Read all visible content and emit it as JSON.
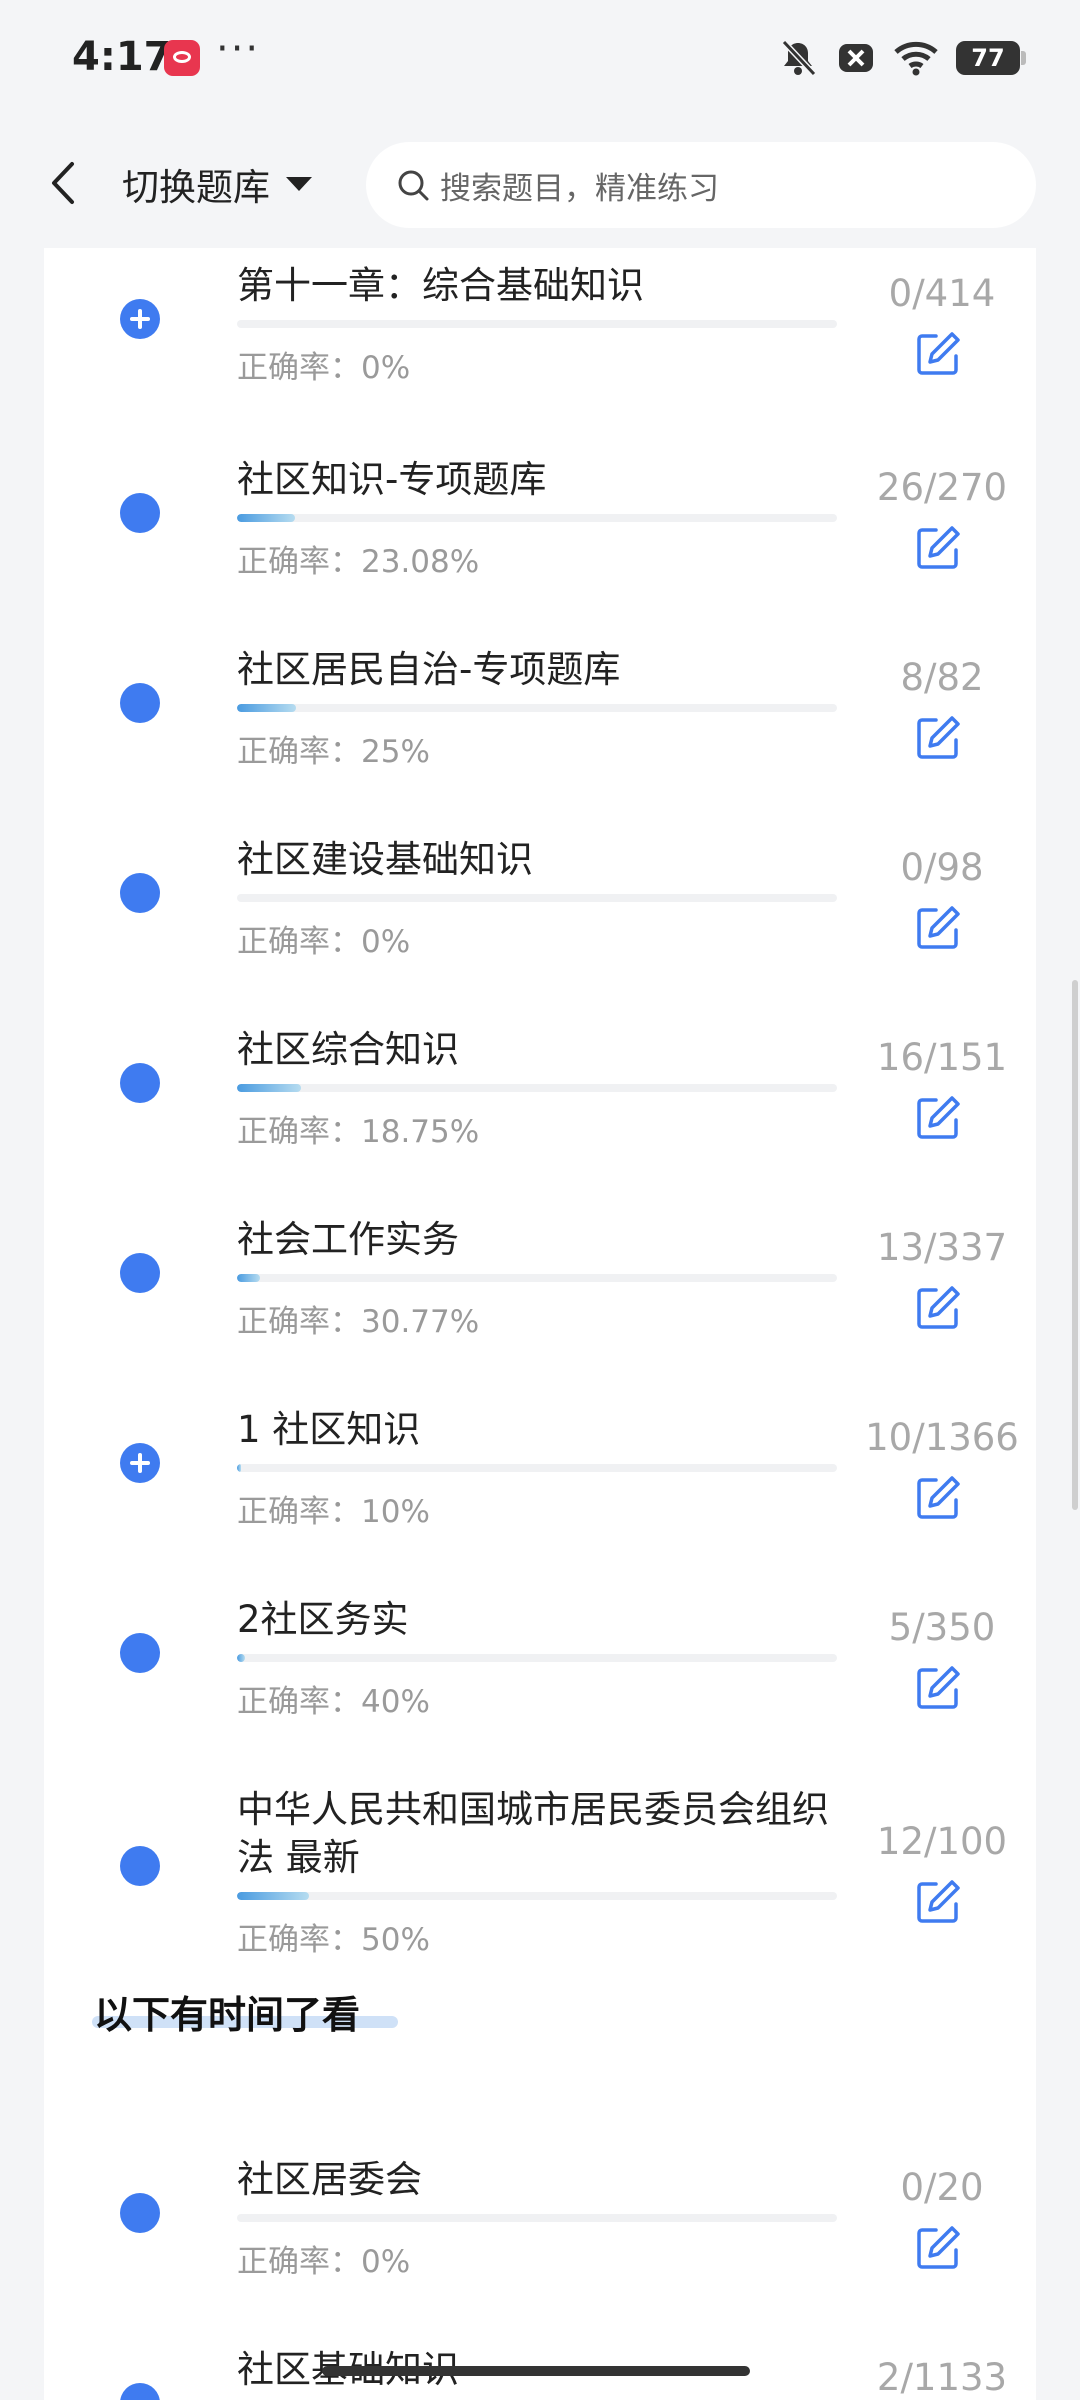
{
  "status": {
    "time": "4:17",
    "more": "···",
    "battery": "77"
  },
  "header": {
    "switch_label": "切换题库",
    "search_placeholder": "搜索题目，精准练习"
  },
  "rate_prefix": "正确率：",
  "items": [
    {
      "title": "第十一章：综合基础知识",
      "count": "0/414",
      "rate": "正确率：0%",
      "progress": 0.0,
      "expandable": true
    },
    {
      "title": "社区知识-专项题库",
      "count": "26/270",
      "rate": "正确率：23.08%",
      "progress": 0.096,
      "expandable": false
    },
    {
      "title": "社区居民自治-专项题库",
      "count": "8/82",
      "rate": "正确率：25%",
      "progress": 0.098,
      "expandable": false
    },
    {
      "title": "社区建设基础知识",
      "count": "0/98",
      "rate": "正确率：0%",
      "progress": 0.0,
      "expandable": false
    },
    {
      "title": "社区综合知识",
      "count": "16/151",
      "rate": "正确率：18.75%",
      "progress": 0.106,
      "expandable": false
    },
    {
      "title": "社会工作实务",
      "count": "13/337",
      "rate": "正确率：30.77%",
      "progress": 0.039,
      "expandable": false
    },
    {
      "title": "1 社区知识",
      "count": "10/1366",
      "rate": "正确率：10%",
      "progress": 0.007,
      "expandable": true
    },
    {
      "title": "2社区务实",
      "count": "5/350",
      "rate": "正确率：40%",
      "progress": 0.014,
      "expandable": false
    },
    {
      "title": "中华人民共和国城市居民委员会组织法 最新",
      "count": "12/100",
      "rate": "正确率：50%",
      "progress": 0.12,
      "expandable": false
    },
    {
      "title": "社区居委会",
      "count": "0/20",
      "rate": "正确率：0%",
      "progress": 0.0,
      "expandable": false
    },
    {
      "title": "社区基础知识",
      "count": "2/1133",
      "rate": "",
      "progress": 0.002,
      "expandable": false
    }
  ],
  "section_title": "以下有时间了看",
  "colors": {
    "accent": "#3f7bf0",
    "progress_start": "#4a9be0",
    "progress_end": "#b6dcf0"
  }
}
